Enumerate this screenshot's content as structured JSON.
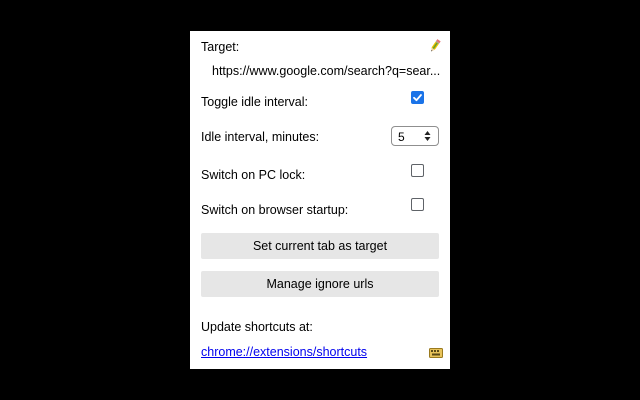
{
  "popup": {
    "target_label": "Target:",
    "target_url": "https://www.google.com/search?q=sear...",
    "toggle_idle_label": "Toggle idle interval:",
    "toggle_idle_checked": true,
    "idle_interval_label": "Idle interval, minutes:",
    "idle_interval_value": "5",
    "switch_pc_lock_label": "Switch on PC lock:",
    "switch_pc_lock_checked": false,
    "switch_startup_label": "Switch on browser startup:",
    "switch_startup_checked": false,
    "set_target_button": "Set current tab as target",
    "manage_ignore_button": "Manage ignore urls",
    "update_shortcuts_label": "Update shortcuts at:",
    "shortcuts_link": "chrome://extensions/shortcuts"
  },
  "icons": {
    "target_edit": "pencil-icon",
    "shortcuts": "keyboard-icon"
  },
  "colors": {
    "checkbox_accent": "#1a73e8",
    "button_bg": "#e6e6e6",
    "link": "#0000ee"
  }
}
